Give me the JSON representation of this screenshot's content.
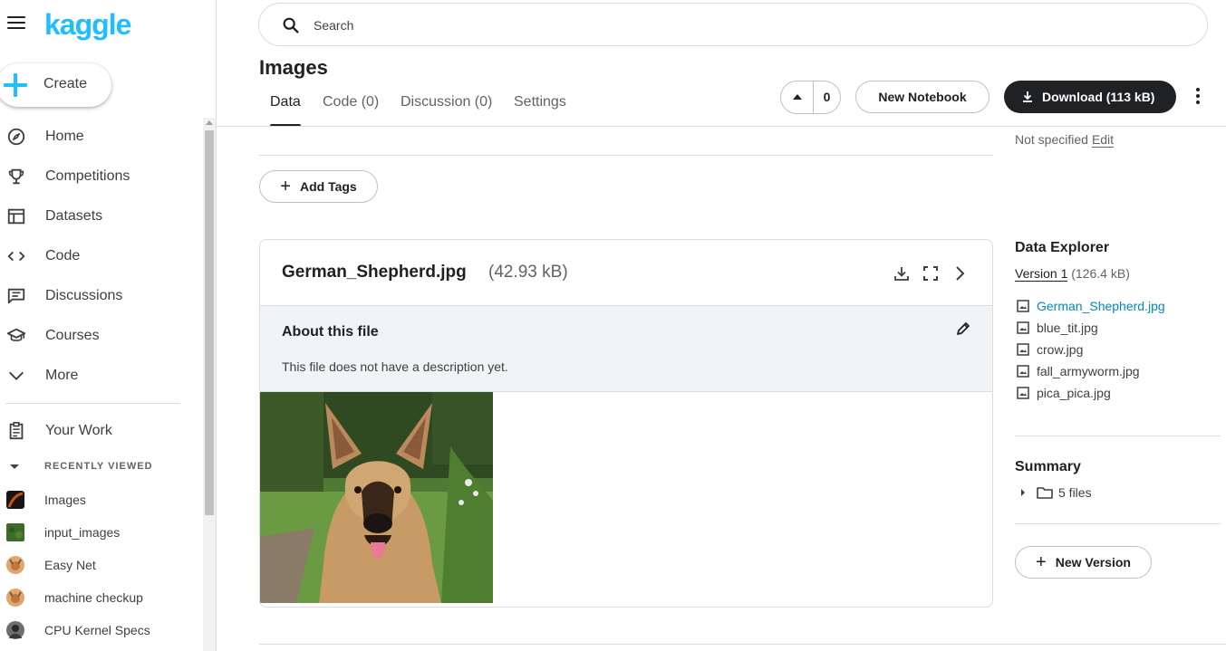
{
  "app": {
    "logo_text": "kaggle",
    "brand_color": "#20beff"
  },
  "sidebar": {
    "create_label": "Create",
    "items": [
      {
        "label": "Home",
        "icon": "compass-icon"
      },
      {
        "label": "Competitions",
        "icon": "trophy-icon"
      },
      {
        "label": "Datasets",
        "icon": "table-icon"
      },
      {
        "label": "Code",
        "icon": "code-brackets-icon"
      },
      {
        "label": "Discussions",
        "icon": "comments-icon"
      },
      {
        "label": "Courses",
        "icon": "graduation-cap-icon"
      },
      {
        "label": "More",
        "icon": "chevron-down-icon"
      }
    ],
    "your_work_label": "Your Work",
    "recently_viewed_label": "RECENTLY VIEWED",
    "recent": [
      {
        "label": "Images"
      },
      {
        "label": "input_images"
      },
      {
        "label": "Easy Net"
      },
      {
        "label": "machine checkup"
      },
      {
        "label": "CPU Kernel Specs"
      }
    ]
  },
  "search": {
    "placeholder": "Search"
  },
  "header": {
    "title": "Images",
    "tabs": [
      {
        "label": "Data",
        "active": true
      },
      {
        "label": "Code (0)"
      },
      {
        "label": "Discussion (0)"
      },
      {
        "label": "Settings"
      }
    ],
    "vote_count": "0",
    "new_notebook_label": "New Notebook",
    "download_label": "Download (113 kB)"
  },
  "main": {
    "add_tags_label": "Add Tags",
    "file": {
      "name": "German_Shepherd.jpg",
      "size": "(42.93 kB)",
      "about_title": "About this file",
      "description": "This file does not have a description yet."
    }
  },
  "right": {
    "not_specified": "Not specified",
    "edit_label": "Edit",
    "data_explorer_title": "Data Explorer",
    "version_label": "Version 1",
    "version_size": "(126.4 kB)",
    "files": [
      {
        "name": "German_Shepherd.jpg",
        "selected": true
      },
      {
        "name": "blue_tit.jpg"
      },
      {
        "name": "crow.jpg"
      },
      {
        "name": "fall_armyworm.jpg"
      },
      {
        "name": "pica_pica.jpg"
      }
    ],
    "summary_title": "Summary",
    "summary_files": "5 files",
    "new_version_label": "New Version"
  },
  "colors": {
    "text_primary": "#202124",
    "text_secondary": "#5f6368",
    "border": "#dadce0",
    "link_selected": "#008abc",
    "dark_button": "#202124"
  }
}
